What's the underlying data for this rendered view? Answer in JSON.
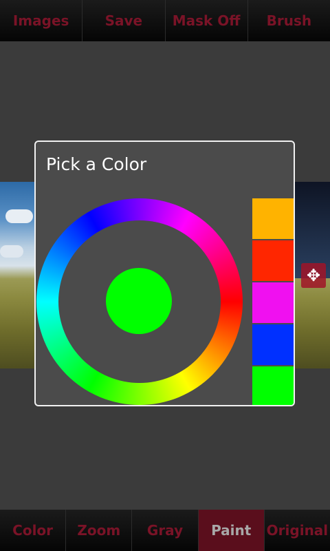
{
  "top_toolbar": {
    "items": [
      {
        "label": "Images"
      },
      {
        "label": "Save"
      },
      {
        "label": "Mask Off"
      },
      {
        "label": "Brush"
      }
    ]
  },
  "bottom_toolbar": {
    "active": "Paint",
    "items": [
      {
        "label": "Color"
      },
      {
        "label": "Zoom"
      },
      {
        "label": "Gray"
      },
      {
        "label": "Paint"
      },
      {
        "label": "Original"
      }
    ]
  },
  "dialog": {
    "title": "Pick a Color",
    "selected_color": "#00ff00",
    "swatches": [
      "#ffb300",
      "#ff2600",
      "#f010f0",
      "#0030ff",
      "#00ff00"
    ]
  },
  "colors": {
    "toolbar_text": "#7a1327",
    "active_tab_bg": "#5a0e1c",
    "dialog_bg": "#4b4b4b"
  },
  "icons": {
    "move_handle": "move-arrows-icon"
  }
}
